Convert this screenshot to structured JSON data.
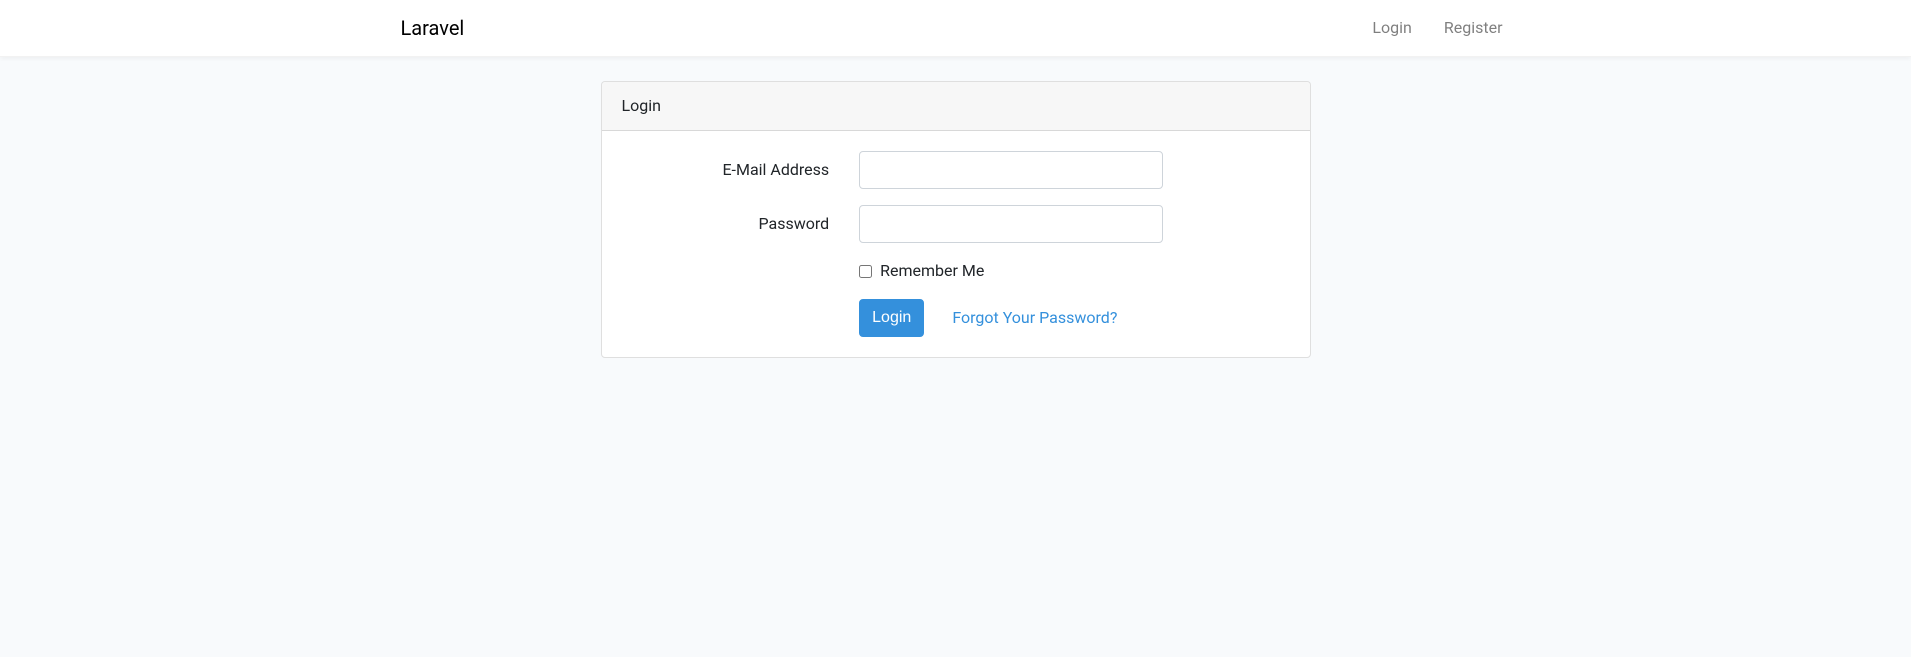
{
  "navbar": {
    "brand": "Laravel",
    "login_link": "Login",
    "register_link": "Register"
  },
  "card": {
    "header": "Login",
    "form": {
      "email_label": "E-Mail Address",
      "email_value": "",
      "password_label": "Password",
      "password_value": "",
      "remember_label": "Remember Me",
      "submit_label": "Login",
      "forgot_link": "Forgot Your Password?"
    }
  }
}
